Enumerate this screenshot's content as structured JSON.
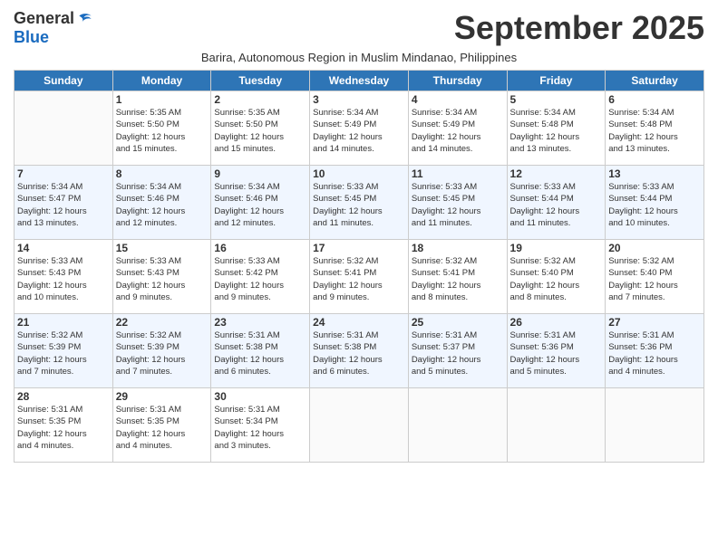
{
  "header": {
    "logo_general": "General",
    "logo_blue": "Blue",
    "month_title": "September 2025",
    "subtitle": "Barira, Autonomous Region in Muslim Mindanao, Philippines"
  },
  "days_of_week": [
    "Sunday",
    "Monday",
    "Tuesday",
    "Wednesday",
    "Thursday",
    "Friday",
    "Saturday"
  ],
  "weeks": [
    [
      {
        "day": "",
        "info": ""
      },
      {
        "day": "1",
        "info": "Sunrise: 5:35 AM\nSunset: 5:50 PM\nDaylight: 12 hours\nand 15 minutes."
      },
      {
        "day": "2",
        "info": "Sunrise: 5:35 AM\nSunset: 5:50 PM\nDaylight: 12 hours\nand 15 minutes."
      },
      {
        "day": "3",
        "info": "Sunrise: 5:34 AM\nSunset: 5:49 PM\nDaylight: 12 hours\nand 14 minutes."
      },
      {
        "day": "4",
        "info": "Sunrise: 5:34 AM\nSunset: 5:49 PM\nDaylight: 12 hours\nand 14 minutes."
      },
      {
        "day": "5",
        "info": "Sunrise: 5:34 AM\nSunset: 5:48 PM\nDaylight: 12 hours\nand 13 minutes."
      },
      {
        "day": "6",
        "info": "Sunrise: 5:34 AM\nSunset: 5:48 PM\nDaylight: 12 hours\nand 13 minutes."
      }
    ],
    [
      {
        "day": "7",
        "info": "Sunrise: 5:34 AM\nSunset: 5:47 PM\nDaylight: 12 hours\nand 13 minutes."
      },
      {
        "day": "8",
        "info": "Sunrise: 5:34 AM\nSunset: 5:46 PM\nDaylight: 12 hours\nand 12 minutes."
      },
      {
        "day": "9",
        "info": "Sunrise: 5:34 AM\nSunset: 5:46 PM\nDaylight: 12 hours\nand 12 minutes."
      },
      {
        "day": "10",
        "info": "Sunrise: 5:33 AM\nSunset: 5:45 PM\nDaylight: 12 hours\nand 11 minutes."
      },
      {
        "day": "11",
        "info": "Sunrise: 5:33 AM\nSunset: 5:45 PM\nDaylight: 12 hours\nand 11 minutes."
      },
      {
        "day": "12",
        "info": "Sunrise: 5:33 AM\nSunset: 5:44 PM\nDaylight: 12 hours\nand 11 minutes."
      },
      {
        "day": "13",
        "info": "Sunrise: 5:33 AM\nSunset: 5:44 PM\nDaylight: 12 hours\nand 10 minutes."
      }
    ],
    [
      {
        "day": "14",
        "info": "Sunrise: 5:33 AM\nSunset: 5:43 PM\nDaylight: 12 hours\nand 10 minutes."
      },
      {
        "day": "15",
        "info": "Sunrise: 5:33 AM\nSunset: 5:43 PM\nDaylight: 12 hours\nand 9 minutes."
      },
      {
        "day": "16",
        "info": "Sunrise: 5:33 AM\nSunset: 5:42 PM\nDaylight: 12 hours\nand 9 minutes."
      },
      {
        "day": "17",
        "info": "Sunrise: 5:32 AM\nSunset: 5:41 PM\nDaylight: 12 hours\nand 9 minutes."
      },
      {
        "day": "18",
        "info": "Sunrise: 5:32 AM\nSunset: 5:41 PM\nDaylight: 12 hours\nand 8 minutes."
      },
      {
        "day": "19",
        "info": "Sunrise: 5:32 AM\nSunset: 5:40 PM\nDaylight: 12 hours\nand 8 minutes."
      },
      {
        "day": "20",
        "info": "Sunrise: 5:32 AM\nSunset: 5:40 PM\nDaylight: 12 hours\nand 7 minutes."
      }
    ],
    [
      {
        "day": "21",
        "info": "Sunrise: 5:32 AM\nSunset: 5:39 PM\nDaylight: 12 hours\nand 7 minutes."
      },
      {
        "day": "22",
        "info": "Sunrise: 5:32 AM\nSunset: 5:39 PM\nDaylight: 12 hours\nand 7 minutes."
      },
      {
        "day": "23",
        "info": "Sunrise: 5:31 AM\nSunset: 5:38 PM\nDaylight: 12 hours\nand 6 minutes."
      },
      {
        "day": "24",
        "info": "Sunrise: 5:31 AM\nSunset: 5:38 PM\nDaylight: 12 hours\nand 6 minutes."
      },
      {
        "day": "25",
        "info": "Sunrise: 5:31 AM\nSunset: 5:37 PM\nDaylight: 12 hours\nand 5 minutes."
      },
      {
        "day": "26",
        "info": "Sunrise: 5:31 AM\nSunset: 5:36 PM\nDaylight: 12 hours\nand 5 minutes."
      },
      {
        "day": "27",
        "info": "Sunrise: 5:31 AM\nSunset: 5:36 PM\nDaylight: 12 hours\nand 4 minutes."
      }
    ],
    [
      {
        "day": "28",
        "info": "Sunrise: 5:31 AM\nSunset: 5:35 PM\nDaylight: 12 hours\nand 4 minutes."
      },
      {
        "day": "29",
        "info": "Sunrise: 5:31 AM\nSunset: 5:35 PM\nDaylight: 12 hours\nand 4 minutes."
      },
      {
        "day": "30",
        "info": "Sunrise: 5:31 AM\nSunset: 5:34 PM\nDaylight: 12 hours\nand 3 minutes."
      },
      {
        "day": "",
        "info": ""
      },
      {
        "day": "",
        "info": ""
      },
      {
        "day": "",
        "info": ""
      },
      {
        "day": "",
        "info": ""
      }
    ]
  ]
}
